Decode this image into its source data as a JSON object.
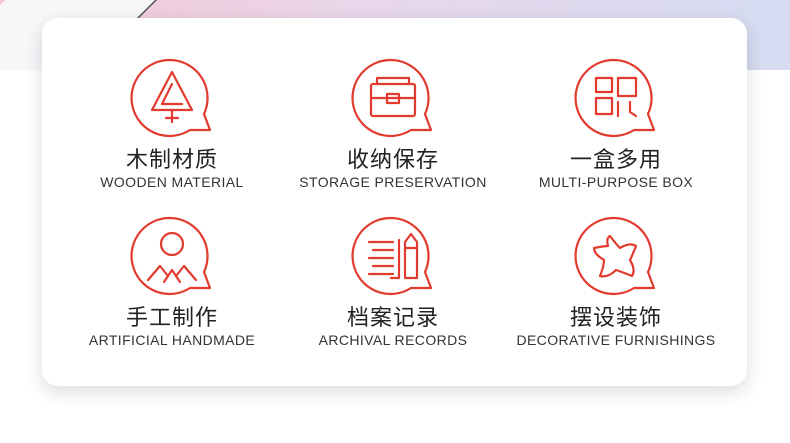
{
  "accent_color": "#e23a2e",
  "features": [
    {
      "icon": "tree-icon",
      "cn": "木制材质",
      "en": "WOODEN MATERIAL"
    },
    {
      "icon": "storage-box-icon",
      "cn": "收纳保存",
      "en": "STORAGE PRESERVATION"
    },
    {
      "icon": "compartments-icon",
      "cn": "一盒多用",
      "en": "MULTI-PURPOSE BOX"
    },
    {
      "icon": "handmade-person-icon",
      "cn": "手工制作",
      "en": "ARTIFICIAL HANDMADE"
    },
    {
      "icon": "documents-pen-icon",
      "cn": "档案记录",
      "en": "ARCHIVAL RECORDS"
    },
    {
      "icon": "star-icon",
      "cn": "摆设装饰",
      "en": "DECORATIVE FURNISHINGS"
    }
  ]
}
